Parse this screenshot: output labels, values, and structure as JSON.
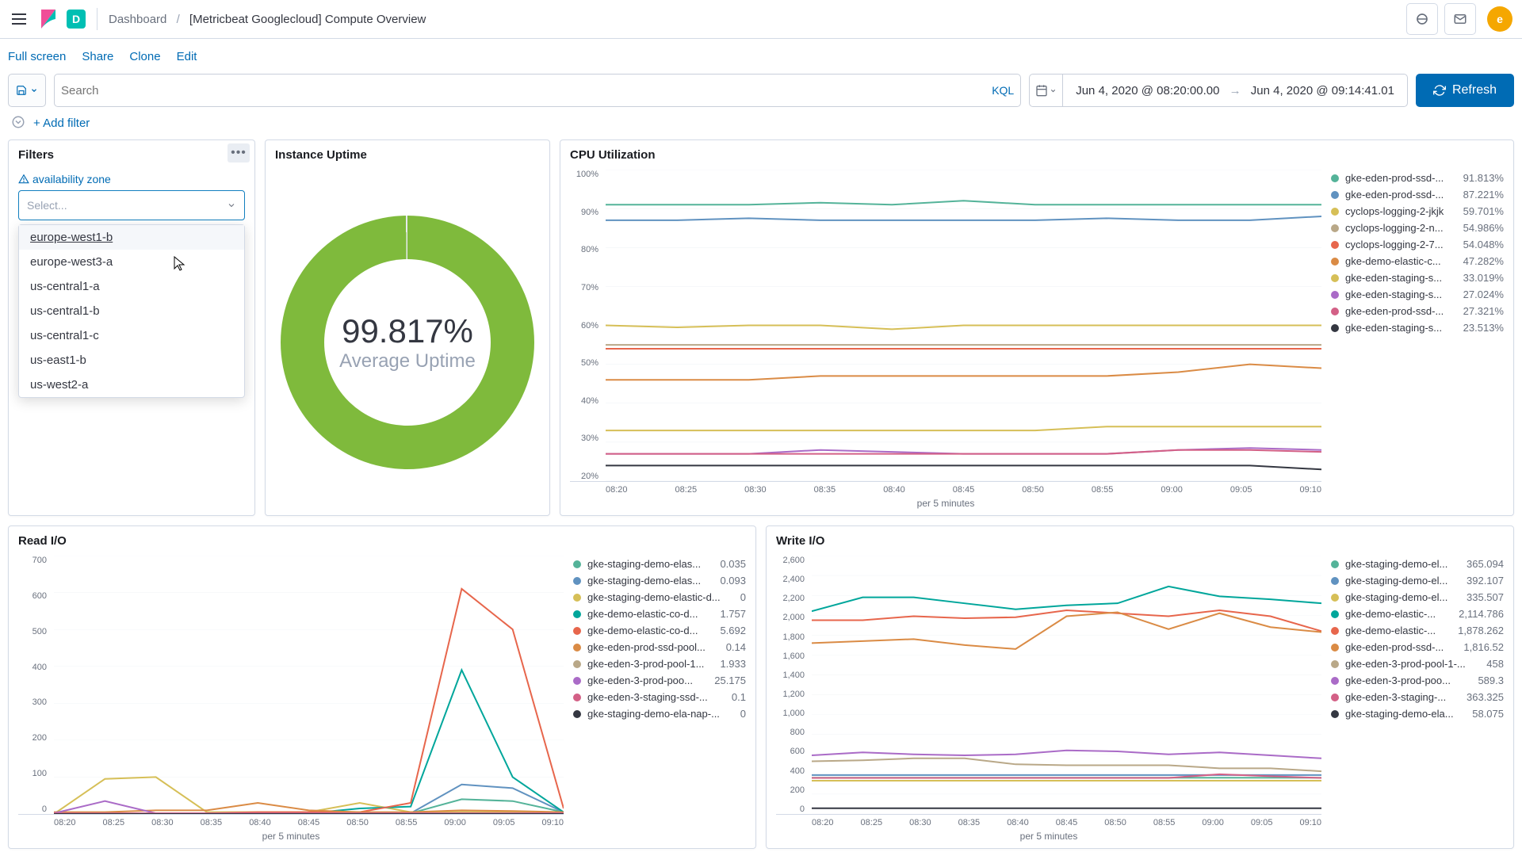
{
  "header": {
    "solution_letter": "D",
    "breadcrumb_root": "Dashboard",
    "breadcrumb_current": "[Metricbeat Googlecloud] Compute Overview",
    "avatar_letter": "e"
  },
  "actions": {
    "fullscreen": "Full screen",
    "share": "Share",
    "clone": "Clone",
    "edit": "Edit"
  },
  "query": {
    "search_placeholder": "Search",
    "kql": "KQL",
    "date_from": "Jun 4, 2020 @ 08:20:00.00",
    "date_to": "Jun 4, 2020 @ 09:14:41.01",
    "refresh": "Refresh"
  },
  "filters_bar": {
    "add_filter": "+ Add filter"
  },
  "panels": {
    "filters": {
      "title": "Filters",
      "field_label": "availability zone",
      "select_placeholder": "Select...",
      "dropdown": [
        "europe-west1-b",
        "europe-west3-a",
        "us-central1-a",
        "us-central1-b",
        "us-central1-c",
        "us-east1-b",
        "us-west2-a"
      ]
    },
    "uptime": {
      "title": "Instance Uptime",
      "value": "99.817%",
      "label": "Average Uptime"
    },
    "cpu": {
      "title": "CPU Utilization",
      "xlabel": "per 5 minutes"
    },
    "read": {
      "title": "Read I/O",
      "xlabel": "per 5 minutes"
    },
    "write": {
      "title": "Write I/O",
      "xlabel": "per 5 minutes"
    }
  },
  "chart_data": [
    {
      "id": "cpu",
      "type": "line",
      "x": [
        "08:20",
        "08:25",
        "08:30",
        "08:35",
        "08:40",
        "08:45",
        "08:50",
        "08:55",
        "09:00",
        "09:05",
        "09:10"
      ],
      "y_ticks": [
        "100%",
        "90%",
        "80%",
        "70%",
        "60%",
        "50%",
        "40%",
        "30%",
        "20%"
      ],
      "ylim": [
        20,
        100
      ],
      "series": [
        {
          "name": "gke-eden-prod-ssd-...",
          "color": "#54b399",
          "value": "91.813%",
          "data": [
            91,
            91,
            91,
            91.5,
            91,
            92,
            91,
            91,
            91,
            91,
            91
          ]
        },
        {
          "name": "gke-eden-prod-ssd-...",
          "color": "#6092c0",
          "value": "87.221%",
          "data": [
            87,
            87,
            87.5,
            87,
            87,
            87,
            87,
            87.5,
            87,
            87,
            88
          ]
        },
        {
          "name": "cyclops-logging-2-jkjk",
          "color": "#d6bf57",
          "value": "59.701%",
          "data": [
            60,
            59.5,
            60,
            60,
            59,
            60,
            60,
            60,
            60,
            60,
            60
          ]
        },
        {
          "name": "cyclops-logging-2-n...",
          "color": "#b9a888",
          "value": "54.986%",
          "data": [
            55,
            55,
            55,
            55,
            55,
            55,
            55,
            55,
            55,
            55,
            55
          ]
        },
        {
          "name": "cyclops-logging-2-7...",
          "color": "#e7664c",
          "value": "54.048%",
          "data": [
            54,
            54,
            54,
            54,
            54,
            54,
            54,
            54,
            54,
            54,
            54
          ]
        },
        {
          "name": "gke-demo-elastic-c...",
          "color": "#da8b45",
          "value": "47.282%",
          "data": [
            46,
            46,
            46,
            47,
            47,
            47,
            47,
            47,
            48,
            50,
            49
          ]
        },
        {
          "name": "gke-eden-staging-s...",
          "color": "#d6bf57",
          "value": "33.019%",
          "data": [
            33,
            33,
            33,
            33,
            33,
            33,
            33,
            34,
            34,
            34,
            34
          ]
        },
        {
          "name": "gke-eden-staging-s...",
          "color": "#aa6bc7",
          "value": "27.024%",
          "data": [
            27,
            27,
            27,
            28,
            27.5,
            27,
            27,
            27,
            28,
            28.5,
            28
          ]
        },
        {
          "name": "gke-eden-prod-ssd-...",
          "color": "#d36086",
          "value": "27.321%",
          "data": [
            27,
            27,
            27,
            27,
            27,
            27,
            27,
            27,
            28,
            28,
            27.5
          ]
        },
        {
          "name": "gke-eden-staging-s...",
          "color": "#343741",
          "value": "23.513%",
          "data": [
            24,
            24,
            24,
            24,
            24,
            24,
            24,
            24,
            24,
            24,
            23
          ]
        }
      ]
    },
    {
      "id": "read",
      "type": "line",
      "x": [
        "08:20",
        "08:25",
        "08:30",
        "08:35",
        "08:40",
        "08:45",
        "08:50",
        "08:55",
        "09:00",
        "09:05",
        "09:10"
      ],
      "y_ticks": [
        "700",
        "600",
        "500",
        "400",
        "300",
        "200",
        "100",
        "0"
      ],
      "ylim": [
        0,
        700
      ],
      "series": [
        {
          "name": "gke-staging-demo-elas...",
          "color": "#54b399",
          "value": "0.035",
          "data": [
            2,
            2,
            2,
            2,
            2,
            2,
            2,
            2,
            40,
            35,
            5
          ]
        },
        {
          "name": "gke-staging-demo-elas...",
          "color": "#6092c0",
          "value": "0.093",
          "data": [
            2,
            2,
            2,
            2,
            2,
            2,
            2,
            2,
            80,
            70,
            5
          ]
        },
        {
          "name": "gke-staging-demo-elastic-d...",
          "color": "#d6bf57",
          "value": "0",
          "data": [
            0,
            95,
            100,
            5,
            5,
            5,
            30,
            5,
            5,
            5,
            5
          ]
        },
        {
          "name": "gke-demo-elastic-co-d...",
          "color": "#00a69b",
          "value": "1.757",
          "data": [
            2,
            2,
            2,
            2,
            2,
            2,
            15,
            20,
            390,
            100,
            5
          ]
        },
        {
          "name": "gke-demo-elastic-co-d...",
          "color": "#e7664c",
          "value": "5.692",
          "data": [
            2,
            2,
            2,
            2,
            5,
            5,
            5,
            30,
            610,
            500,
            15
          ]
        },
        {
          "name": "gke-eden-prod-ssd-pool...",
          "color": "#da8b45",
          "value": "0.14",
          "data": [
            5,
            5,
            10,
            10,
            30,
            10,
            5,
            5,
            10,
            8,
            5
          ]
        },
        {
          "name": "gke-eden-3-prod-pool-1...",
          "color": "#b9a888",
          "value": "1.933",
          "data": [
            2,
            2,
            2,
            2,
            2,
            2,
            2,
            2,
            2,
            2,
            2
          ]
        },
        {
          "name": "gke-eden-3-prod-poo...",
          "color": "#aa6bc7",
          "value": "25.175",
          "data": [
            2,
            35,
            2,
            2,
            2,
            2,
            2,
            2,
            2,
            2,
            2
          ]
        },
        {
          "name": "gke-eden-3-staging-ssd-...",
          "color": "#d36086",
          "value": "0.1",
          "data": [
            2,
            2,
            2,
            2,
            2,
            2,
            2,
            2,
            2,
            2,
            2
          ]
        },
        {
          "name": "gke-staging-demo-ela-nap-...",
          "color": "#343741",
          "value": "0",
          "data": [
            0,
            0,
            0,
            0,
            0,
            0,
            0,
            0,
            0,
            0,
            0
          ]
        }
      ]
    },
    {
      "id": "write",
      "type": "line",
      "x": [
        "08:20",
        "08:25",
        "08:30",
        "08:35",
        "08:40",
        "08:45",
        "08:50",
        "08:55",
        "09:00",
        "09:05",
        "09:10"
      ],
      "y_ticks": [
        "2,600",
        "2,400",
        "2,200",
        "2,000",
        "1,800",
        "1,600",
        "1,400",
        "1,200",
        "1,000",
        "800",
        "600",
        "400",
        "200",
        "0"
      ],
      "ylim": [
        0,
        2600
      ],
      "series": [
        {
          "name": "gke-staging-demo-el...",
          "color": "#54b399",
          "value": "365.094",
          "data": [
            365,
            365,
            365,
            365,
            365,
            365,
            365,
            365,
            365,
            365,
            365
          ]
        },
        {
          "name": "gke-staging-demo-el...",
          "color": "#6092c0",
          "value": "392.107",
          "data": [
            392,
            392,
            392,
            392,
            392,
            392,
            392,
            392,
            392,
            392,
            392
          ]
        },
        {
          "name": "gke-staging-demo-el...",
          "color": "#d6bf57",
          "value": "335.507",
          "data": [
            335,
            335,
            335,
            335,
            335,
            335,
            335,
            335,
            335,
            335,
            335
          ]
        },
        {
          "name": "gke-demo-elastic-...",
          "color": "#00a69b",
          "value": "2,114.786",
          "data": [
            2040,
            2180,
            2180,
            2120,
            2060,
            2100,
            2120,
            2290,
            2190,
            2160,
            2120
          ]
        },
        {
          "name": "gke-demo-elastic-...",
          "color": "#e7664c",
          "value": "1,878.262",
          "data": [
            1950,
            1950,
            1990,
            1970,
            1980,
            2050,
            2020,
            1990,
            2050,
            1990,
            1840
          ]
        },
        {
          "name": "gke-eden-prod-ssd-...",
          "color": "#da8b45",
          "value": "1,816.52",
          "data": [
            1720,
            1740,
            1760,
            1700,
            1660,
            1990,
            2030,
            1860,
            2020,
            1880,
            1830
          ]
        },
        {
          "name": "gke-eden-3-prod-pool-1-...",
          "color": "#b9a888",
          "value": "458",
          "data": [
            530,
            540,
            560,
            560,
            500,
            490,
            490,
            490,
            460,
            460,
            430
          ]
        },
        {
          "name": "gke-eden-3-prod-poo...",
          "color": "#aa6bc7",
          "value": "589.3",
          "data": [
            590,
            620,
            600,
            590,
            600,
            640,
            630,
            600,
            620,
            590,
            560
          ]
        },
        {
          "name": "gke-eden-3-staging-...",
          "color": "#d36086",
          "value": "363.325",
          "data": [
            363,
            363,
            363,
            363,
            363,
            363,
            363,
            363,
            400,
            380,
            363
          ]
        },
        {
          "name": "gke-staging-demo-ela...",
          "color": "#343741",
          "value": "58.075",
          "data": [
            58,
            58,
            58,
            58,
            58,
            58,
            58,
            58,
            58,
            58,
            58
          ]
        }
      ]
    }
  ]
}
